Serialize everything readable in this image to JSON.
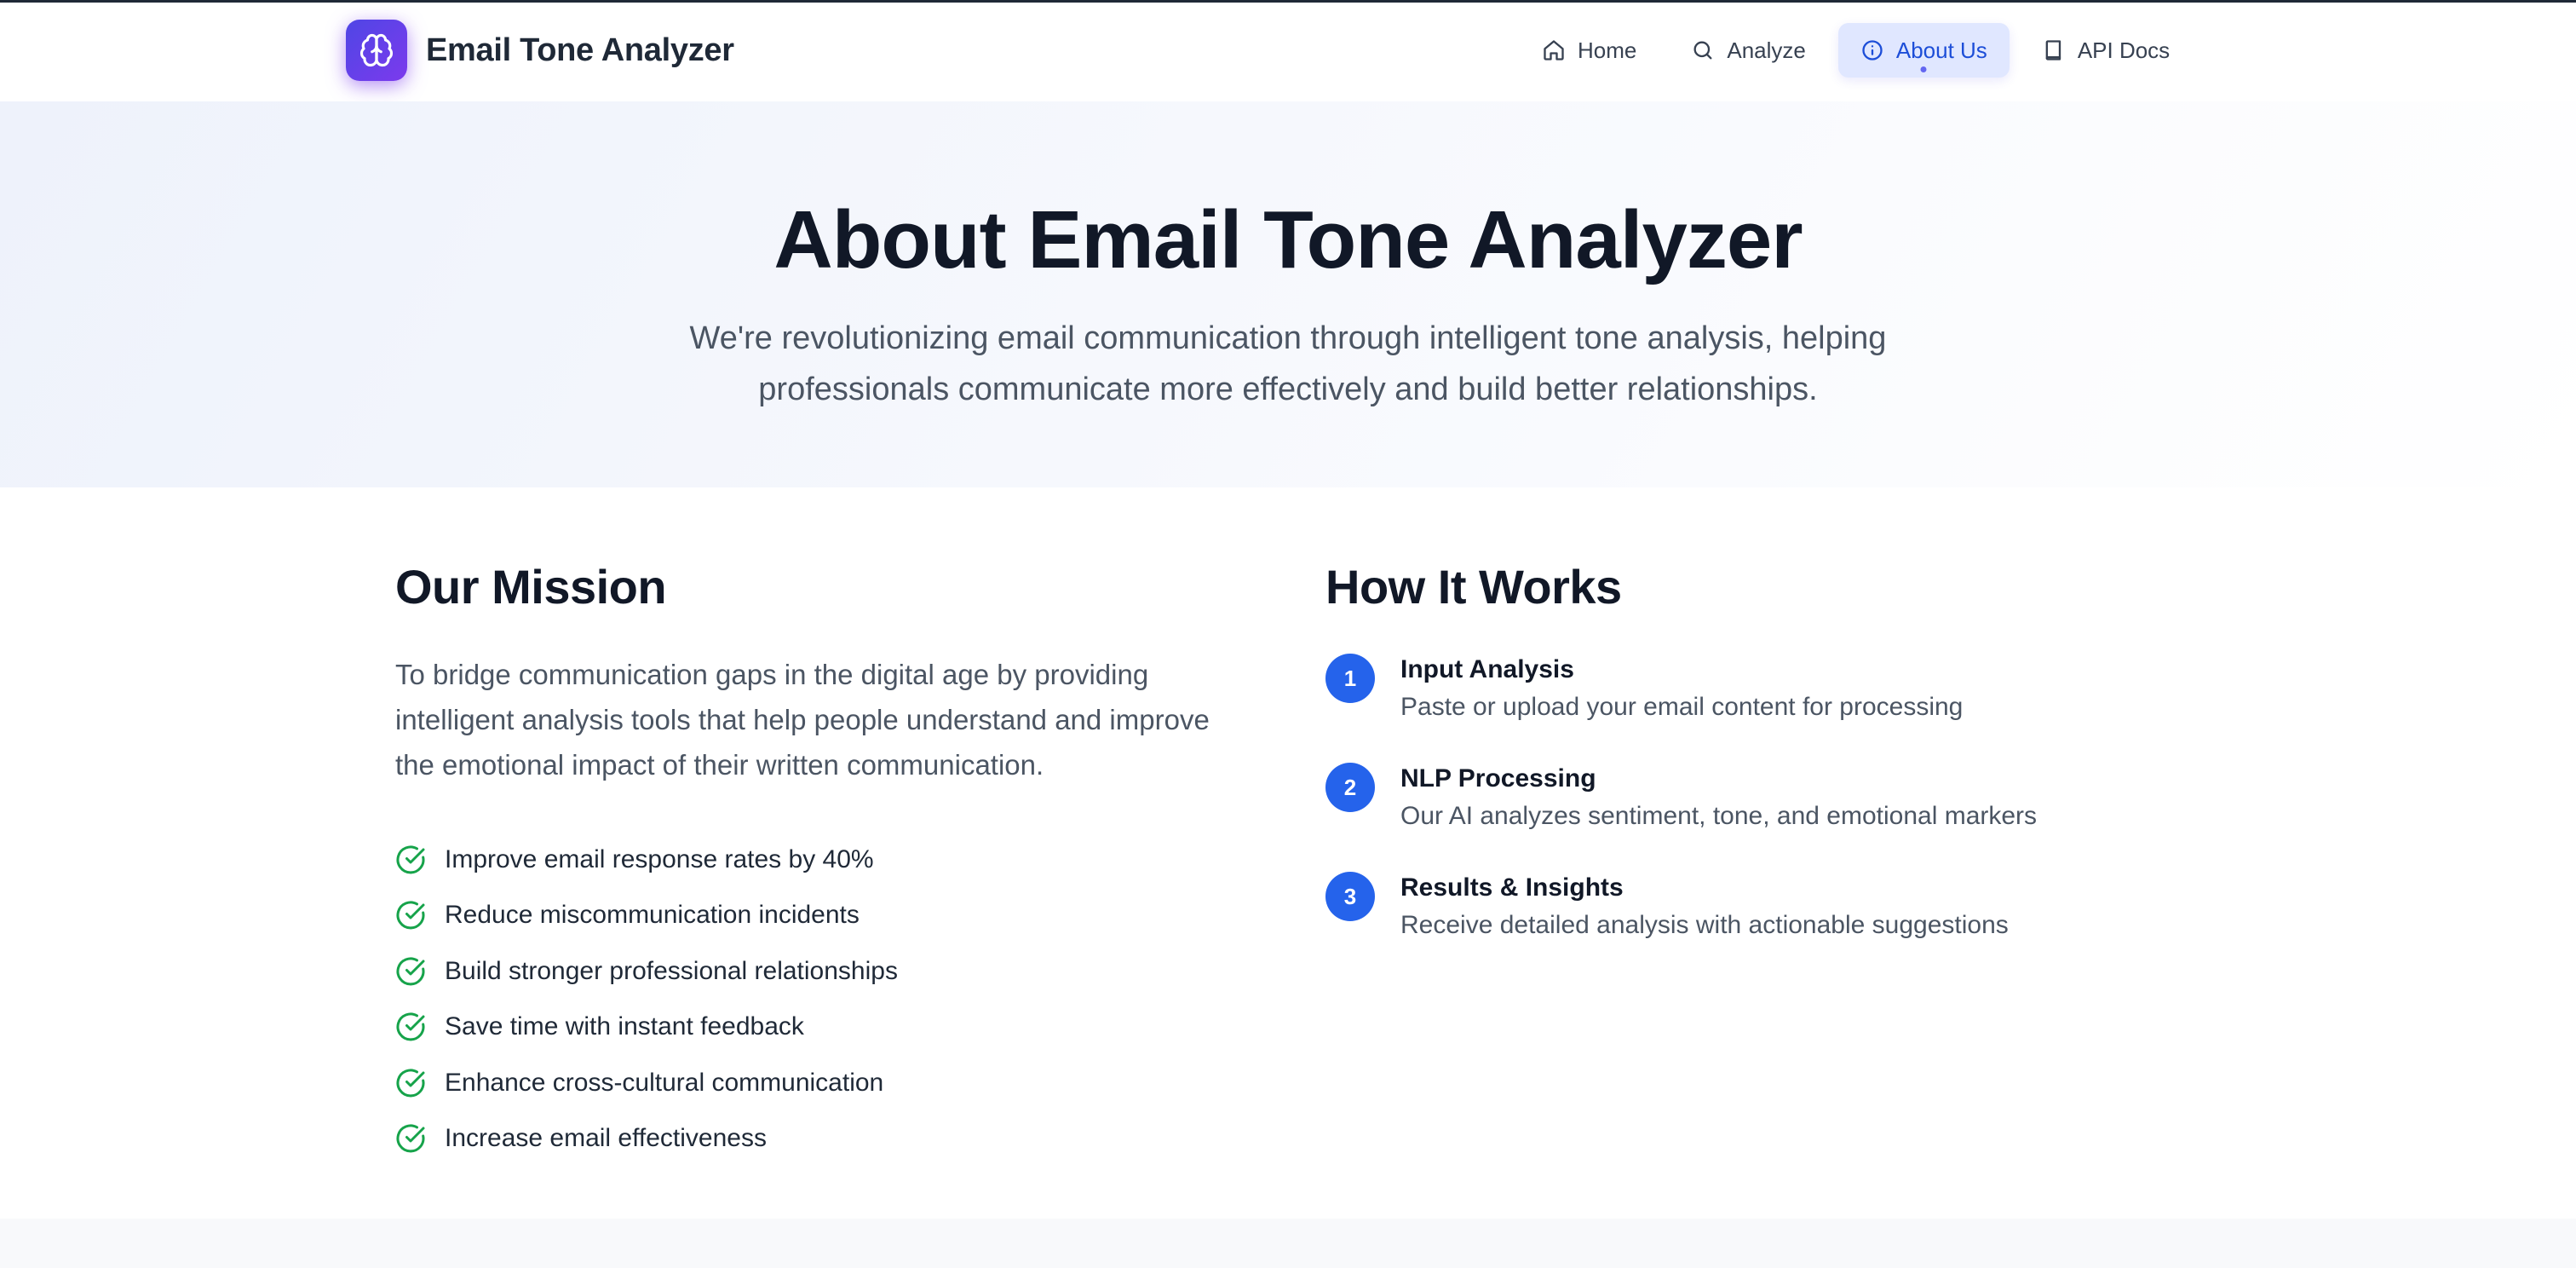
{
  "header": {
    "brand_title": "Email Tone Analyzer",
    "brand_icon": "brain-icon",
    "nav": [
      {
        "label": "Home",
        "icon": "home-icon",
        "active": false
      },
      {
        "label": "Analyze",
        "icon": "search-icon",
        "active": false
      },
      {
        "label": "About Us",
        "icon": "info-icon",
        "active": true
      },
      {
        "label": "API Docs",
        "icon": "book-icon",
        "active": false
      }
    ]
  },
  "hero": {
    "title": "About Email Tone Analyzer",
    "subtitle": "We're revolutionizing email communication through intelligent tone analysis, helping professionals communicate more effectively and build better relationships."
  },
  "mission": {
    "title": "Our Mission",
    "text": "To bridge communication gaps in the digital age by providing intelligent analysis tools that help people understand and improve the emotional impact of their written communication.",
    "benefits": [
      "Improve email response rates by 40%",
      "Reduce miscommunication incidents",
      "Build stronger professional relationships",
      "Save time with instant feedback",
      "Enhance cross-cultural communication",
      "Increase email effectiveness"
    ]
  },
  "how_it_works": {
    "title": "How It Works",
    "steps": [
      {
        "number": "1",
        "title": "Input Analysis",
        "description": "Paste or upload your email content for processing"
      },
      {
        "number": "2",
        "title": "NLP Processing",
        "description": "Our AI analyzes sentiment, tone, and emotional markers"
      },
      {
        "number": "3",
        "title": "Results & Insights",
        "description": "Receive detailed analysis with actionable suggestions"
      }
    ]
  },
  "colors": {
    "accent": "#2563eb",
    "brand_gradient_start": "#4f46e5",
    "brand_gradient_end": "#7c3aed",
    "check": "#16a34a",
    "active_nav_bg": "#e0e7ff"
  }
}
